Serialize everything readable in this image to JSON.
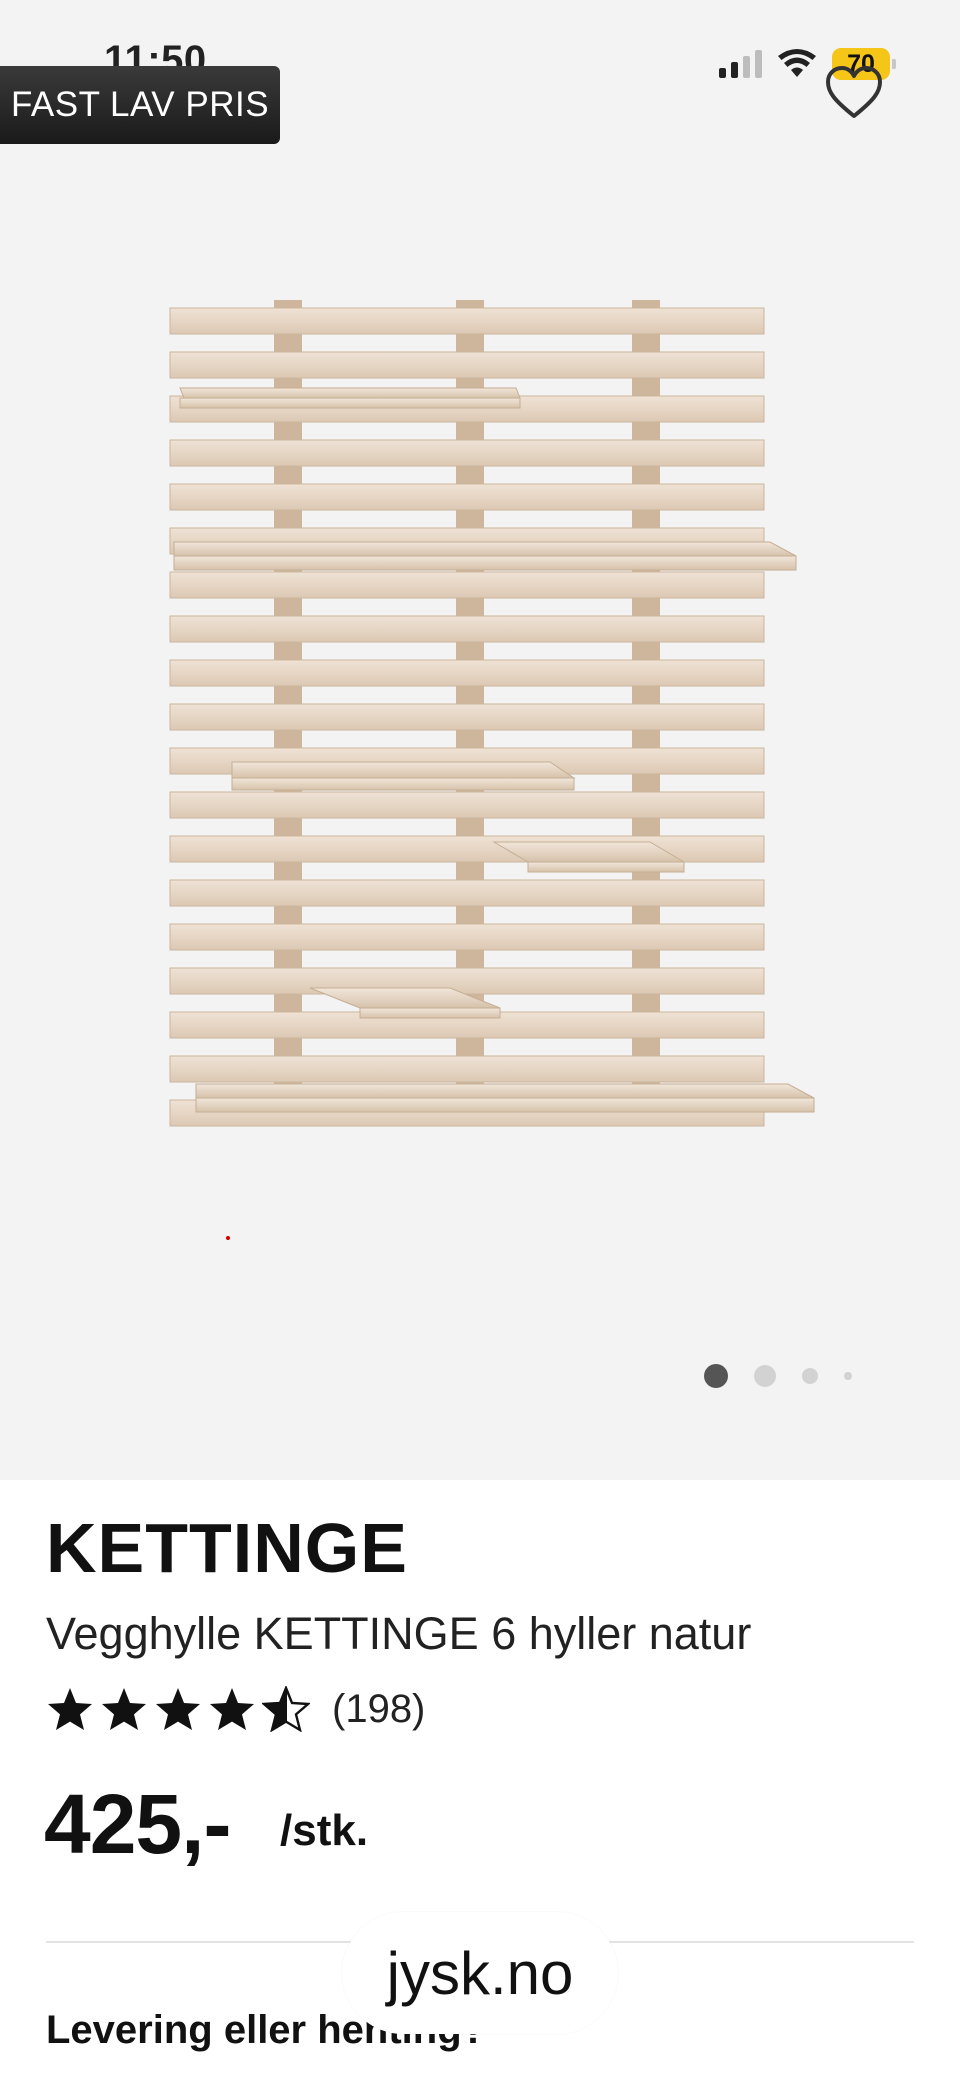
{
  "status_bar": {
    "time": "11:50",
    "battery": "70"
  },
  "badge": {
    "label": "FAST LAV PRIS"
  },
  "gallery": {
    "active_index": 0,
    "count": 4
  },
  "product": {
    "brand": "KETTINGE",
    "name": "Vegghylle KETTINGE 6 hyller natur",
    "rating": 4.5,
    "reviews": "(198)",
    "price": "425,-",
    "unit": "/stk."
  },
  "section": {
    "delivery_title": "Levering eller henting?"
  },
  "browser": {
    "url": "jysk.no"
  },
  "colors": {
    "accent": "#f5c518",
    "hero_bg": "#f3f3f4",
    "wood": "#e8d8c6"
  }
}
